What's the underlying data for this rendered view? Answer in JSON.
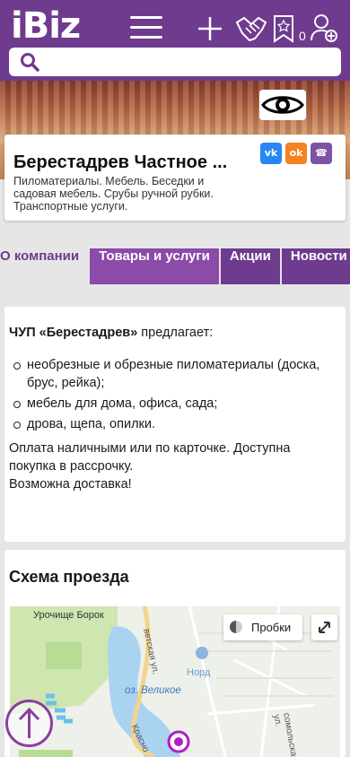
{
  "header": {
    "logo": "iBiz",
    "bookmarks_count": "0",
    "colors": {
      "brand": "#6e3b8f",
      "tab_light": "#8c4aa9"
    }
  },
  "search": {
    "placeholder": ""
  },
  "company": {
    "name": "Берестадрев Частное ...",
    "description": "Пиломатериалы. Мебель. Беседки и садовая мебель. Срубы ручной рубки. Транспортные услуги.",
    "social": [
      "vk",
      "ok",
      "viber"
    ]
  },
  "tabs": [
    {
      "label": "О компании"
    },
    {
      "label": "Товары и услуги"
    },
    {
      "label": "Акции"
    },
    {
      "label": "Новости"
    }
  ],
  "about": {
    "company_name": "ЧУП «Берестадрев»",
    "intro_rest": " предлагает:",
    "items": [
      "необрезные и обрезные пиломатериалы (доска, брус, рейка);",
      "мебель для дома, офиса, сада;",
      "дрова, щепа, опилки."
    ],
    "payment": "Оплата наличными или по карточке. Доступна покупка в рассрочку.",
    "delivery": "Возможна доставка!"
  },
  "map": {
    "title": "Схема проезда",
    "traffic_label": "Пробки",
    "labels": {
      "tract": "Урочище Борок",
      "lake": "оз. Великое",
      "nord": "Норд",
      "street1": "ветская ул.",
      "street2": "сомольская ул.",
      "street3": "Красно"
    }
  }
}
